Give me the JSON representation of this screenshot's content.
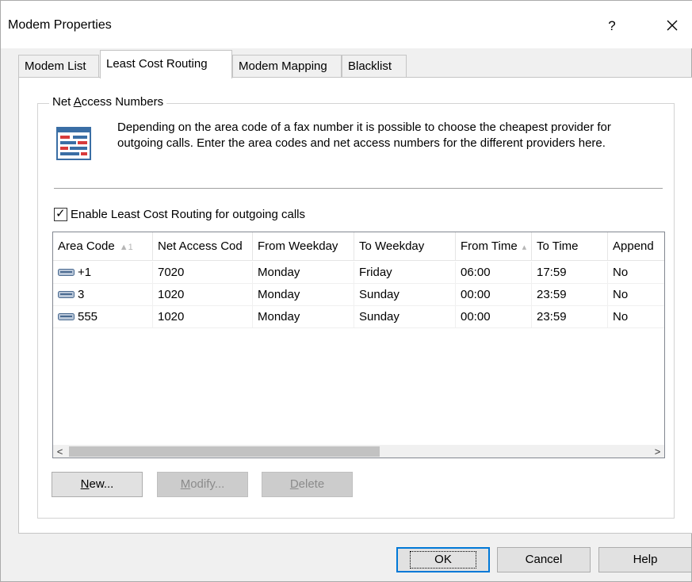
{
  "window": {
    "title": "Modem Properties",
    "help_glyph": "?",
    "close_glyph": "✕"
  },
  "tabs": [
    {
      "label": "Modem List"
    },
    {
      "label": "Least Cost Routing"
    },
    {
      "label": "Modem Mapping"
    },
    {
      "label": "Blacklist"
    }
  ],
  "group": {
    "label_pre": "Net ",
    "label_mnemonic": "A",
    "label_post": "ccess Numbers",
    "info_text": "Depending on the area code of a fax number it is possible to choose the cheapest provider for outgoing calls. Enter the area codes and net access numbers for the different providers here."
  },
  "checkbox": {
    "label": "Enable Least Cost Routing for outgoing calls",
    "checked_glyph": "✓",
    "checked": true
  },
  "table": {
    "columns": [
      {
        "label": "Area Code",
        "sort_glyph": "▲1"
      },
      {
        "label": "Net Access Cod"
      },
      {
        "label": "From Weekday"
      },
      {
        "label": "To Weekday"
      },
      {
        "label": "From Time",
        "sort_glyph": "▴"
      },
      {
        "label": "To Time"
      },
      {
        "label": "Append"
      }
    ],
    "rows": [
      {
        "area_code": "+1",
        "net_access": "7020",
        "from_weekday": "Monday",
        "to_weekday": "Friday",
        "from_time": "06:00",
        "to_time": "17:59",
        "append": "No"
      },
      {
        "area_code": "3",
        "net_access": "1020",
        "from_weekday": "Monday",
        "to_weekday": "Sunday",
        "from_time": "00:00",
        "to_time": "23:59",
        "append": "No"
      },
      {
        "area_code": "555",
        "net_access": "1020",
        "from_weekday": "Monday",
        "to_weekday": "Sunday",
        "from_time": "00:00",
        "to_time": "23:59",
        "append": "No"
      }
    ],
    "scroll_left_glyph": "<",
    "scroll_right_glyph": ">"
  },
  "buttons": {
    "new_mnemonic": "N",
    "new_rest": "ew...",
    "modify_mnemonic": "M",
    "modify_rest": "odify...",
    "delete_mnemonic": "D",
    "delete_rest": "elete",
    "ok": "OK",
    "cancel": "Cancel",
    "help": "Help"
  }
}
